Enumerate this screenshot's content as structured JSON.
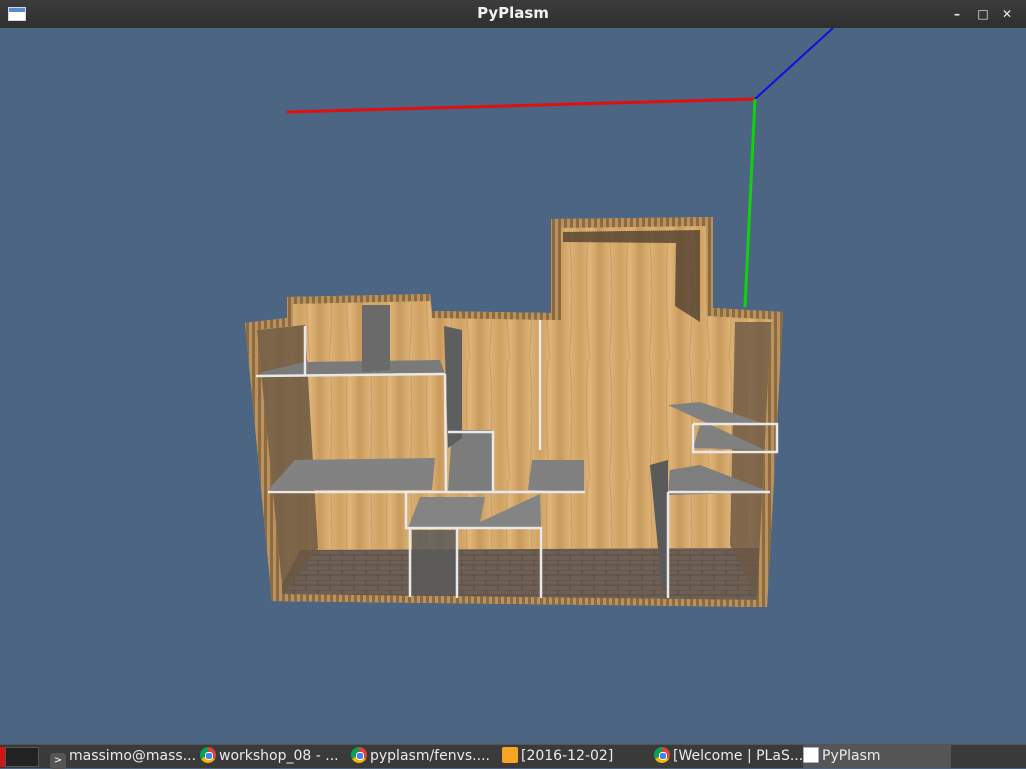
{
  "window": {
    "title": "PyPlasm",
    "app_icon": "window-icon",
    "controls": [
      "minimize-icon",
      "maximize-icon",
      "close-icon"
    ],
    "control_glyphs": {
      "minimize": "–",
      "maximize": "□",
      "close": "✕"
    }
  },
  "scene": {
    "background_color": "#4b6582",
    "axes": {
      "x_color": "#e01010",
      "y_color": "#10d010",
      "z_color": "#1010e0"
    },
    "model": "3D floor plan model with wooden walls, grey floors and brick ground"
  },
  "taskbar": {
    "items": [
      {
        "icon": "terminal-icon",
        "label": "massimo@mass..."
      },
      {
        "icon": "chrome-icon",
        "label": "workshop_08 - ..."
      },
      {
        "icon": "chrome-icon",
        "label": "pyplasm/fenvs...."
      },
      {
        "icon": "folder-icon",
        "label": "[2016-12-02]"
      },
      {
        "icon": "chrome-icon",
        "label": "[Welcome | PLaS..."
      },
      {
        "icon": "window-icon",
        "label": "PyPlasm"
      }
    ]
  }
}
